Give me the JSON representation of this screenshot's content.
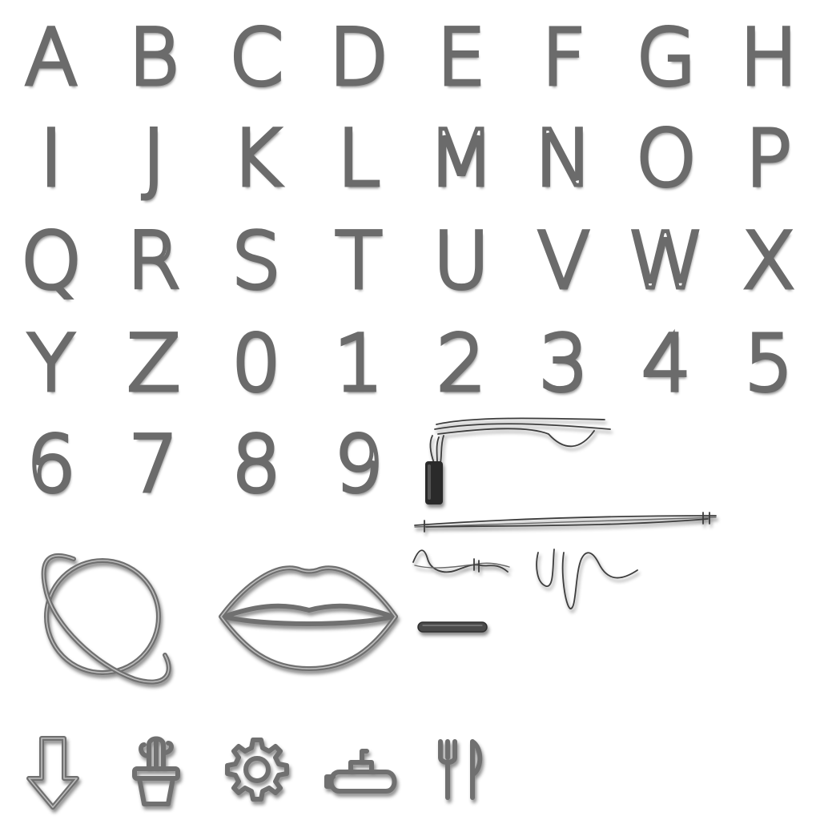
{
  "glyphs": [
    "A",
    "B",
    "C",
    "D",
    "E",
    "F",
    "G",
    "H",
    "I",
    "J",
    "K",
    "L",
    "M",
    "N",
    "O",
    "P",
    "Q",
    "R",
    "S",
    "T",
    "U",
    "V",
    "W",
    "X",
    "Y",
    "Z",
    "0",
    "1",
    "2",
    "3",
    "4",
    "5",
    "6",
    "7",
    "8",
    "9"
  ],
  "icons": [
    "planet-icon",
    "lips-icon",
    "plug-cable-icon",
    "wire-straight-icon",
    "wire-wave-icon",
    "wire-squiggle-icon",
    "bar-icon",
    "arrow-down-icon",
    "potted-cactus-icon",
    "gear-icon",
    "submarine-icon",
    "fork-knife-icon"
  ],
  "colors": {
    "tube": "#707070",
    "highlight": "#bdbdbd",
    "wire": "#3d3d3d",
    "plug": "#2a2a2a"
  }
}
